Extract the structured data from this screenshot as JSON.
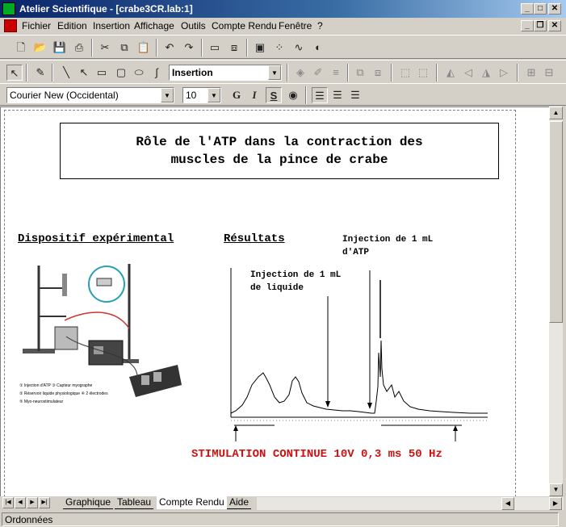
{
  "window": {
    "title": "Atelier Scientifique - [crabe3CR.lab:1]",
    "minimize": "_",
    "maximize": "□",
    "close": "✕"
  },
  "menu": {
    "items": [
      "Fichier",
      "Edition",
      "Insertion",
      "Affichage",
      "Outils",
      "Compte Rendu",
      "Fenêtre",
      "?"
    ]
  },
  "toolbar_draw": {
    "mode_value": "Insertion"
  },
  "toolbar_format": {
    "font_value": "Courier New (Occidental)",
    "size_value": "10",
    "bold": "G",
    "italic": "I",
    "underline": "S"
  },
  "document": {
    "title_line1": "Rôle de l'ATP dans la contraction des",
    "title_line2": "muscles de la pince de crabe",
    "section_setup": "Dispositif expérimental",
    "section_results": "Résultats",
    "annotation_liquid_line1": "Injection de 1 mL",
    "annotation_liquid_line2": "de liquide",
    "annotation_atp_line1": "Injection de 1 mL",
    "annotation_atp_line2": "d'ATP",
    "stimulation": "STIMULATION CONTINUE 10V 0,3 ms 50 Hz",
    "colors": {
      "stimulation": "#cc1111"
    }
  },
  "tabs": [
    "Graphique",
    "Tableau",
    "Compte Rendu",
    "Aide"
  ],
  "active_tab": "Compte Rendu",
  "status": {
    "text": "Ordonnées"
  }
}
